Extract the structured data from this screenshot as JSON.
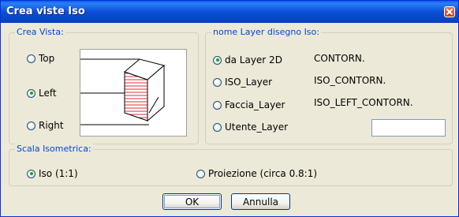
{
  "window": {
    "title": "Crea viste Iso"
  },
  "crea_vista": {
    "legend": "Crea Vista:",
    "options": [
      {
        "label": "Top",
        "selected": false
      },
      {
        "label": "Left",
        "selected": true
      },
      {
        "label": "Right",
        "selected": false
      }
    ]
  },
  "nome_layer": {
    "legend": "nome Layer disegno Iso:",
    "options": [
      {
        "label": "da Layer 2D",
        "selected": true,
        "value": "CONTORN."
      },
      {
        "label": "ISO_Layer",
        "selected": false,
        "value": "ISO_CONTORN."
      },
      {
        "label": "Faccia_Layer",
        "selected": false,
        "value": "ISO_LEFT_CONTORN."
      },
      {
        "label": "Utente_Layer",
        "selected": false,
        "value": ""
      }
    ]
  },
  "scala": {
    "legend": "Scala Isometrica:",
    "options": [
      {
        "label": "Iso (1:1)",
        "selected": true
      },
      {
        "label": "Proiezione (circa 0.8:1)",
        "selected": false
      }
    ]
  },
  "buttons": {
    "ok": "OK",
    "cancel": "Annulla"
  },
  "colors": {
    "titlebar": "#0a4fd6",
    "group_legend": "#0046d5",
    "radio_dot": "#21a121",
    "hatch": "#e0303a"
  }
}
